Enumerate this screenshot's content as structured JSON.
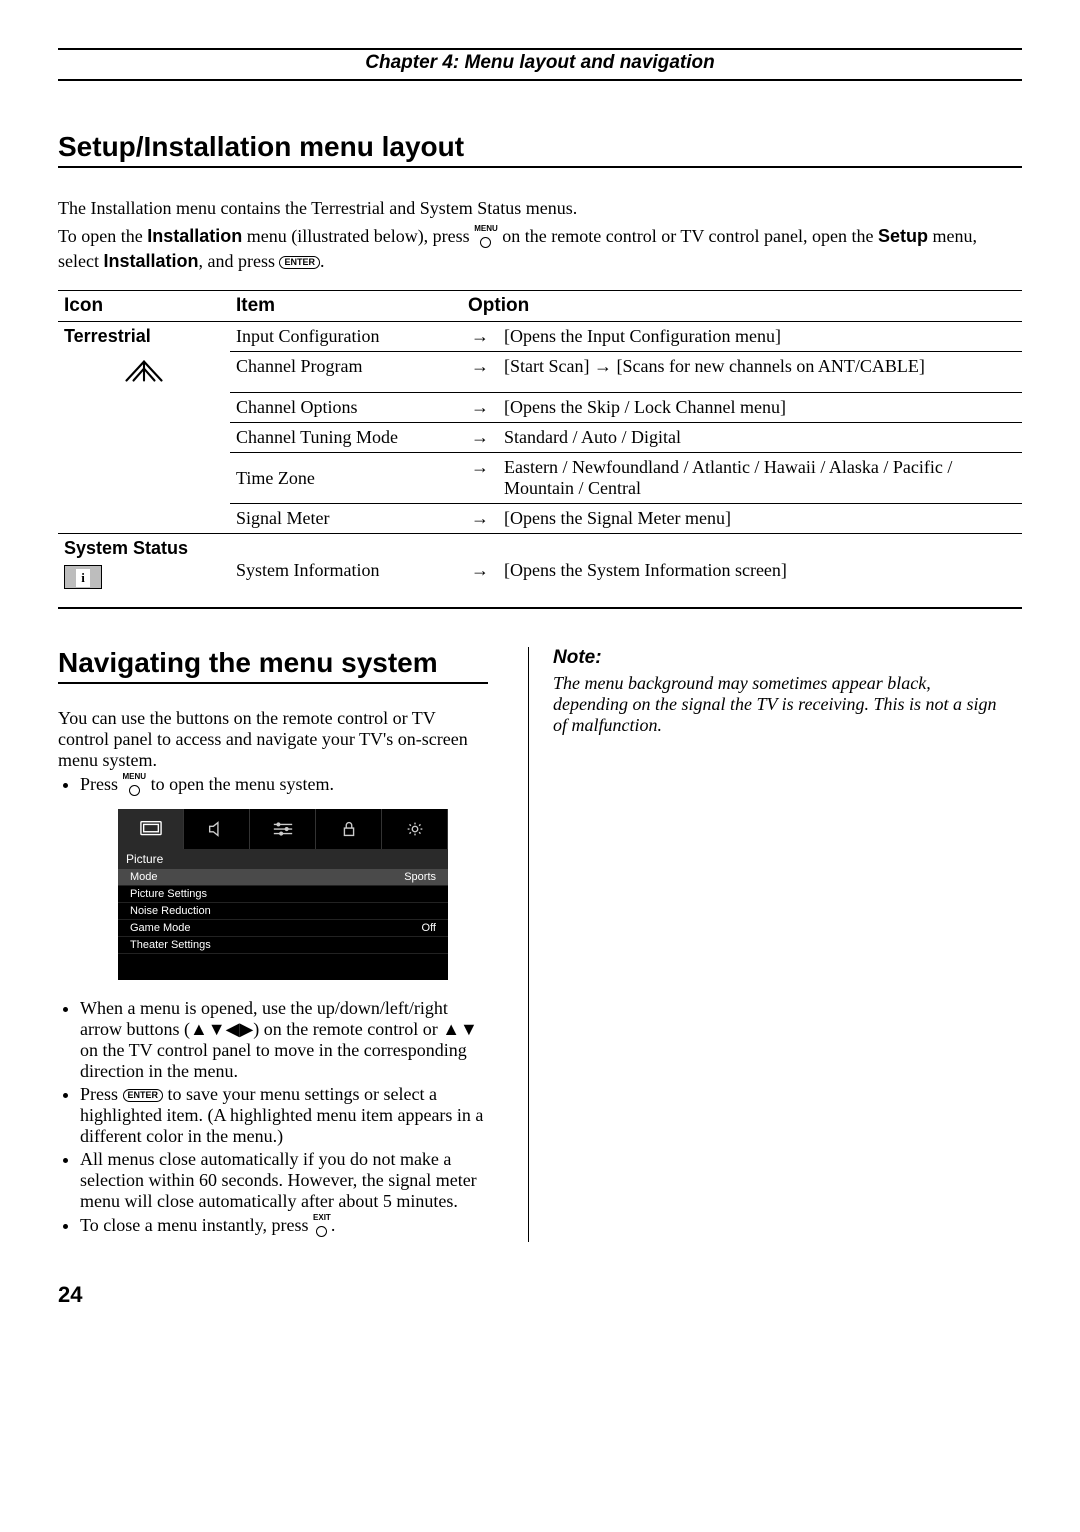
{
  "chapter_header": "Chapter 4: Menu layout and navigation",
  "section1_title": "Setup/Installation menu layout",
  "intro_line": "The Installation menu contains the Terrestrial and System Status menus.",
  "open_line": {
    "a": "To open the ",
    "b": "Installation",
    "c": " menu (illustrated below), press ",
    "menu": "MENU",
    "d": " on the remote control or TV control panel, open the ",
    "e": "Setup",
    "f": " menu, select ",
    "g": "Installation",
    "h": ", and press ",
    "enter": "ENTER",
    "i": "."
  },
  "table": {
    "headers": {
      "icon": "Icon",
      "item": "Item",
      "option": "Option"
    },
    "groups": [
      {
        "label": "Terrestrial",
        "icon": "antenna",
        "rows": [
          {
            "item": "Input Configuration",
            "option": "[Opens the Input Configuration menu]"
          },
          {
            "item": "Channel Program",
            "option": "[Start Scan] → [Scans for new channels on ANT/CABLE]"
          },
          {
            "item": "Channel Options",
            "option": "[Opens the Skip / Lock Channel menu]"
          },
          {
            "item": "Channel Tuning Mode",
            "option": "Standard / Auto / Digital"
          },
          {
            "item": "Time Zone",
            "option": "Eastern / Newfoundland / Atlantic / Hawaii / Alaska / Pacific / Mountain / Central"
          },
          {
            "item": "Signal Meter",
            "option": "[Opens the Signal Meter menu]"
          }
        ]
      },
      {
        "label": "System Status",
        "icon": "info",
        "rows": [
          {
            "item": "System Information",
            "option": "[Opens the System Information screen]"
          }
        ]
      }
    ]
  },
  "section2_title": "Navigating the menu system",
  "nav_intro": "You can use the buttons on the remote control or TV control panel to access and navigate your TV's on-screen menu system.",
  "bullets": {
    "b1a": "Press ",
    "b1b": " to open the menu system.",
    "b2": "When a menu is opened, use the up/down/left/right arrow buttons (▲▼◀▶) on the remote control or ▲▼ on the TV control panel to move in the corresponding direction in the menu.",
    "b3a": "Press ",
    "b3b": " to save your menu settings or select a highlighted item. (A highlighted menu item appears in a different color in the menu.)",
    "b4": "All menus close automatically if you do not make a selection within 60 seconds. However, the signal meter menu will close automatically after about 5 minutes.",
    "b5a": "To close a menu instantly, press ",
    "b5b": ".",
    "exit": "EXIT"
  },
  "tvmenu": {
    "heading": "Picture",
    "rows": [
      {
        "label": "Mode",
        "value": "Sports",
        "sel": true
      },
      {
        "label": "Picture Settings",
        "value": ""
      },
      {
        "label": "Noise Reduction",
        "value": ""
      },
      {
        "label": "Game Mode",
        "value": "Off"
      },
      {
        "label": "Theater Settings",
        "value": ""
      }
    ]
  },
  "note": {
    "head": "Note:",
    "body": "The menu background may sometimes appear black, depending on the signal the TV is receiving. This is not a sign of malfunction."
  },
  "page_number": "24"
}
